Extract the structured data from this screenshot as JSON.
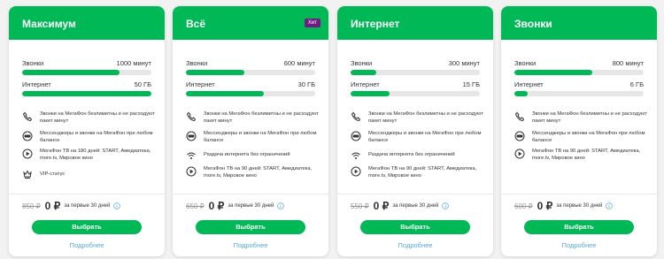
{
  "ui": {
    "price_per": "за первые 30 дней",
    "choose": "Выбрать",
    "more": "Подробнее"
  },
  "cards": [
    {
      "title": "Максимум",
      "minutes_label": "Звонки",
      "minutes": "1000 минут",
      "minutes_fill": 0.75,
      "internet_label": "Интернет",
      "internet": "50 ГБ",
      "internet_fill": 1.0,
      "features": [
        "Звонки на МегаФон безлимитны и не расходуют пакет минут",
        "Мессенджеры и звонки на МегаФон при любом балансе",
        "МегаФон ТВ на 180 дней: START, Амедиатека, more.tv, Мировое кино",
        "VIP-статус"
      ],
      "price_old": "850 ₽",
      "price_new": "0 ₽"
    },
    {
      "title": "Всё",
      "badge": "Хит",
      "minutes_label": "Звонки",
      "minutes": "600 минут",
      "minutes_fill": 0.45,
      "internet_label": "Интернет",
      "internet": "30 ГБ",
      "internet_fill": 0.6,
      "features": [
        "Звонки на МегаФон безлимитны и не расходуют пакет минут",
        "Мессенджеры и звонки на МегаФон при любом балансе",
        "Раздача интернета без ограничений",
        "МегаФон ТВ на 90 дней: START, Амедиатека, more.tv, Мировое кино"
      ],
      "price_old": "650 ₽",
      "price_new": "0 ₽"
    },
    {
      "title": "Интернет",
      "minutes_label": "Звонки",
      "minutes": "300 минут",
      "minutes_fill": 0.2,
      "internet_label": "Интернет",
      "internet": "15 ГБ",
      "internet_fill": 0.3,
      "features": [
        "Звонки на МегаФон безлимитны и не расходуют пакет минут",
        "Мессенджеры и звонки на МегаФон при любом балансе",
        "Раздача интернета без ограничений",
        "МегаФон ТВ на 90 дней: START, Амедиатека, more.tv, Мировое кино"
      ],
      "price_old": "550 ₽",
      "price_new": "0 ₽"
    },
    {
      "title": "Звонки",
      "minutes_label": "Звонки",
      "minutes": "800 минут",
      "minutes_fill": 0.6,
      "internet_label": "Интернет",
      "internet": "6 ГБ",
      "internet_fill": 0.1,
      "features": [
        "Звонки на МегаФон безлимитны и не расходуют пакет минут",
        "Мессенджеры и звонки на МегаФон при любом балансе",
        "МегаФон ТВ на 90 дней: START, Амедиатека, more.tv, Мировое кино"
      ],
      "price_old": "600 ₽",
      "price_new": "0 ₽"
    }
  ],
  "icons": {
    "max": [
      "phone-icon",
      "chat-icon",
      "play-icon",
      "crown-icon"
    ],
    "all": [
      "phone-icon",
      "chat-icon",
      "wifi-icon",
      "play-icon"
    ],
    "net": [
      "phone-icon",
      "chat-icon",
      "wifi-icon",
      "play-icon"
    ],
    "calls": [
      "phone-icon",
      "chat-icon",
      "play-icon"
    ]
  },
  "colors": {
    "brand": "#00b956",
    "badge": "#731982",
    "link": "#5aa7d6"
  }
}
